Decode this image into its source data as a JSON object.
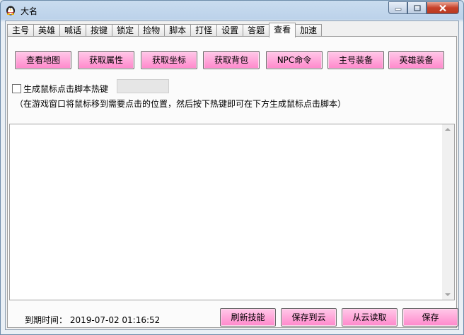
{
  "window": {
    "title": "大名"
  },
  "tabs": [
    {
      "label": "主号"
    },
    {
      "label": "英雄"
    },
    {
      "label": "喊话"
    },
    {
      "label": "按键"
    },
    {
      "label": "锁定"
    },
    {
      "label": "捡物"
    },
    {
      "label": "脚本"
    },
    {
      "label": "打怪"
    },
    {
      "label": "设置"
    },
    {
      "label": "答题"
    },
    {
      "label": "查看"
    },
    {
      "label": "加速"
    }
  ],
  "active_tab": "查看",
  "actions": {
    "view_map": "查看地图",
    "get_attributes": "获取属性",
    "get_coordinates": "获取坐标",
    "get_backpack": "获取背包",
    "npc_command": "NPC命令",
    "main_equip": "主号装备",
    "hero_equip": "英雄装备"
  },
  "hotkey": {
    "checkbox_label": "生成鼠标点击脚本热键",
    "checked": false,
    "value": ""
  },
  "hint": "（在游戏窗口将鼠标移到需要点击的位置，然后按下热键即可在下方生成鼠标点击脚本）",
  "script_text": "",
  "footer": {
    "expire_label": "到期时间：",
    "expire_value": "2019-07-02 01:16:52",
    "refresh_skills": "刷新技能",
    "save_to_cloud": "保存到云",
    "load_from_cloud": "从云读取",
    "save": "保存"
  },
  "colors": {
    "button_pink": "#ff99d6",
    "title_bar": "#c9dcef",
    "close_red": "#c7412a"
  }
}
